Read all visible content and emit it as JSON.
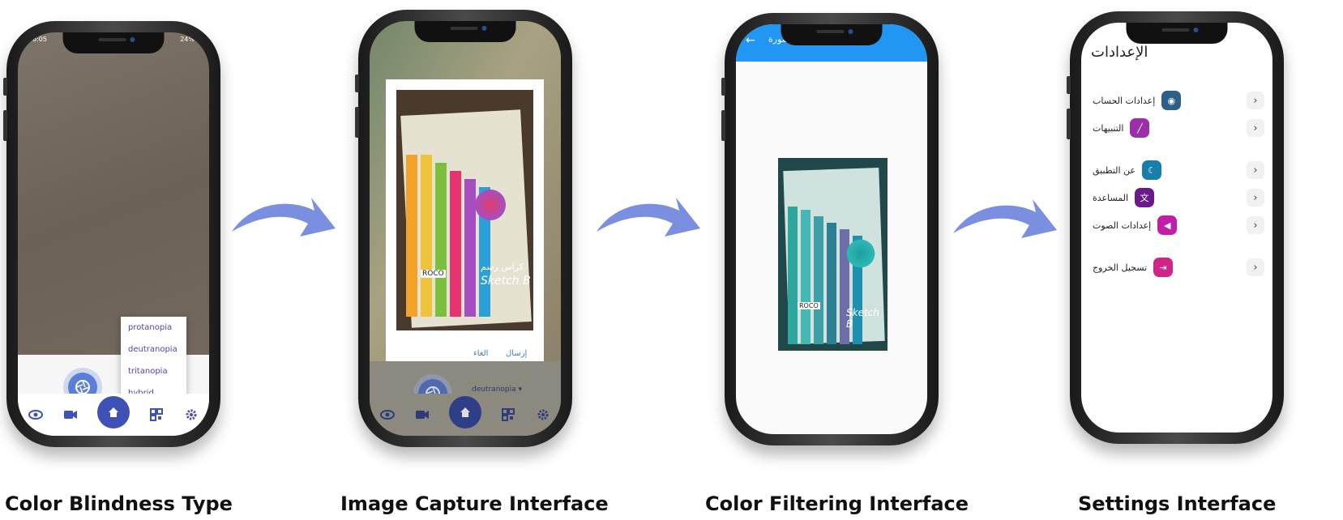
{
  "captions": [
    "Color Blindness Type",
    "Image Capture Interface",
    "Color Filtering Interface",
    "Settings Interface"
  ],
  "phone1": {
    "status_time": "6:05",
    "status_battery": "24%",
    "menu_items": [
      "protanopia",
      "deutranopia",
      "tritanopia",
      "hybrid"
    ]
  },
  "phone2": {
    "dialog_send": "إرسال",
    "dialog_cancel": "الغاء",
    "selected_type": "deutranopia",
    "notebook_brand": "ROCO",
    "notebook_title": "Sketch B",
    "notebook_arabic": "كراس رسم"
  },
  "phone3": {
    "appbar_title": "صورة",
    "notebook_brand": "ROCO",
    "notebook_title": "Sketch B"
  },
  "phone4": {
    "title": "الإعدادات",
    "items": [
      {
        "label": "إعدادات الحساب",
        "icon": "account-icon",
        "color": "#2c5f8a"
      },
      {
        "label": "التنبيهات",
        "icon": "pen-icon",
        "color": "#9c2fa8"
      },
      {
        "label": "عن التطبيق",
        "icon": "moon-icon",
        "color": "#1a7fa8"
      },
      {
        "label": "المساعدة",
        "icon": "translate-icon",
        "color": "#6a1b8a"
      },
      {
        "label": "إعدادات الصوت",
        "icon": "speaker-icon",
        "color": "#c21fa8"
      },
      {
        "label": "تسجيل الخروج",
        "icon": "logout-icon",
        "color": "#d1248a"
      }
    ]
  },
  "colors": {
    "accent": "#3f51b5",
    "arrow": "#7b8fe0",
    "appbar": "#2196f3"
  }
}
